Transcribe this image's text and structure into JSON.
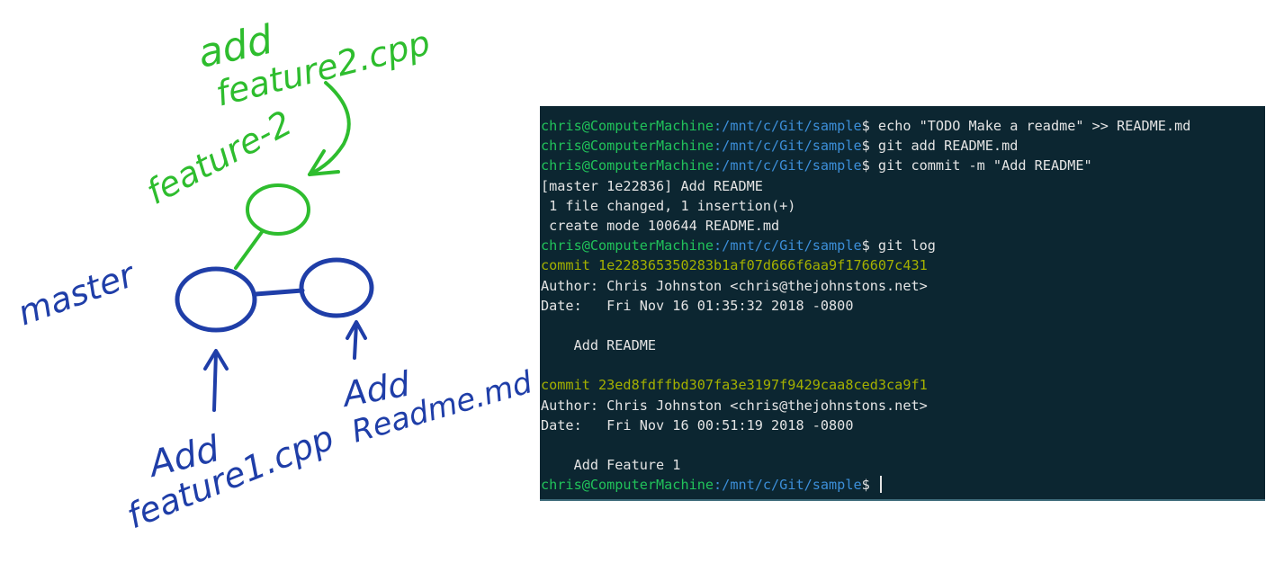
{
  "sketch": {
    "label_add_feature2": [
      "add",
      "feature2.cpp"
    ],
    "label_feature2": "feature-2",
    "label_master": "master",
    "label_add_feature1": [
      "Add",
      "feature1.cpp"
    ],
    "label_add_readme": [
      "Add",
      "Readme.md"
    ],
    "colors": {
      "green": "#2ebd2e",
      "blue": "#1f3ea8"
    }
  },
  "terminal": {
    "prompt_user": "chris@ComputerMachine",
    "prompt_path": ":/mnt/c/Git/sample",
    "prompt_symbol": "$ ",
    "lines": [
      {
        "type": "cmd",
        "text": "echo \"TODO Make a readme\" >> README.md"
      },
      {
        "type": "cmd",
        "text": "git add README.md"
      },
      {
        "type": "cmd",
        "text": "git commit -m \"Add README\""
      },
      {
        "type": "out",
        "text": "[master 1e22836] Add README"
      },
      {
        "type": "out",
        "text": " 1 file changed, 1 insertion(+)"
      },
      {
        "type": "out",
        "text": " create mode 100644 README.md"
      },
      {
        "type": "cmd",
        "text": "git log"
      },
      {
        "type": "commit",
        "text": "commit 1e228365350283b1af07d666f6aa9f176607c431"
      },
      {
        "type": "out",
        "text": "Author: Chris Johnston <chris@thejohnstons.net>"
      },
      {
        "type": "out",
        "text": "Date:   Fri Nov 16 01:35:32 2018 -0800"
      },
      {
        "type": "out",
        "text": ""
      },
      {
        "type": "out",
        "text": "    Add README"
      },
      {
        "type": "out",
        "text": ""
      },
      {
        "type": "commit",
        "text": "commit 23ed8fdffbd307fa3e3197f9429caa8ced3ca9f1"
      },
      {
        "type": "out",
        "text": "Author: Chris Johnston <chris@thejohnstons.net>"
      },
      {
        "type": "out",
        "text": "Date:   Fri Nov 16 00:51:19 2018 -0800"
      },
      {
        "type": "out",
        "text": ""
      },
      {
        "type": "out",
        "text": "    Add Feature 1"
      },
      {
        "type": "prompt",
        "text": ""
      }
    ],
    "colors": {
      "background": "#0c2631",
      "user": "#21c25a",
      "path": "#3c8ed8",
      "commit": "#a4b000",
      "text": "#e4e4e4"
    }
  }
}
